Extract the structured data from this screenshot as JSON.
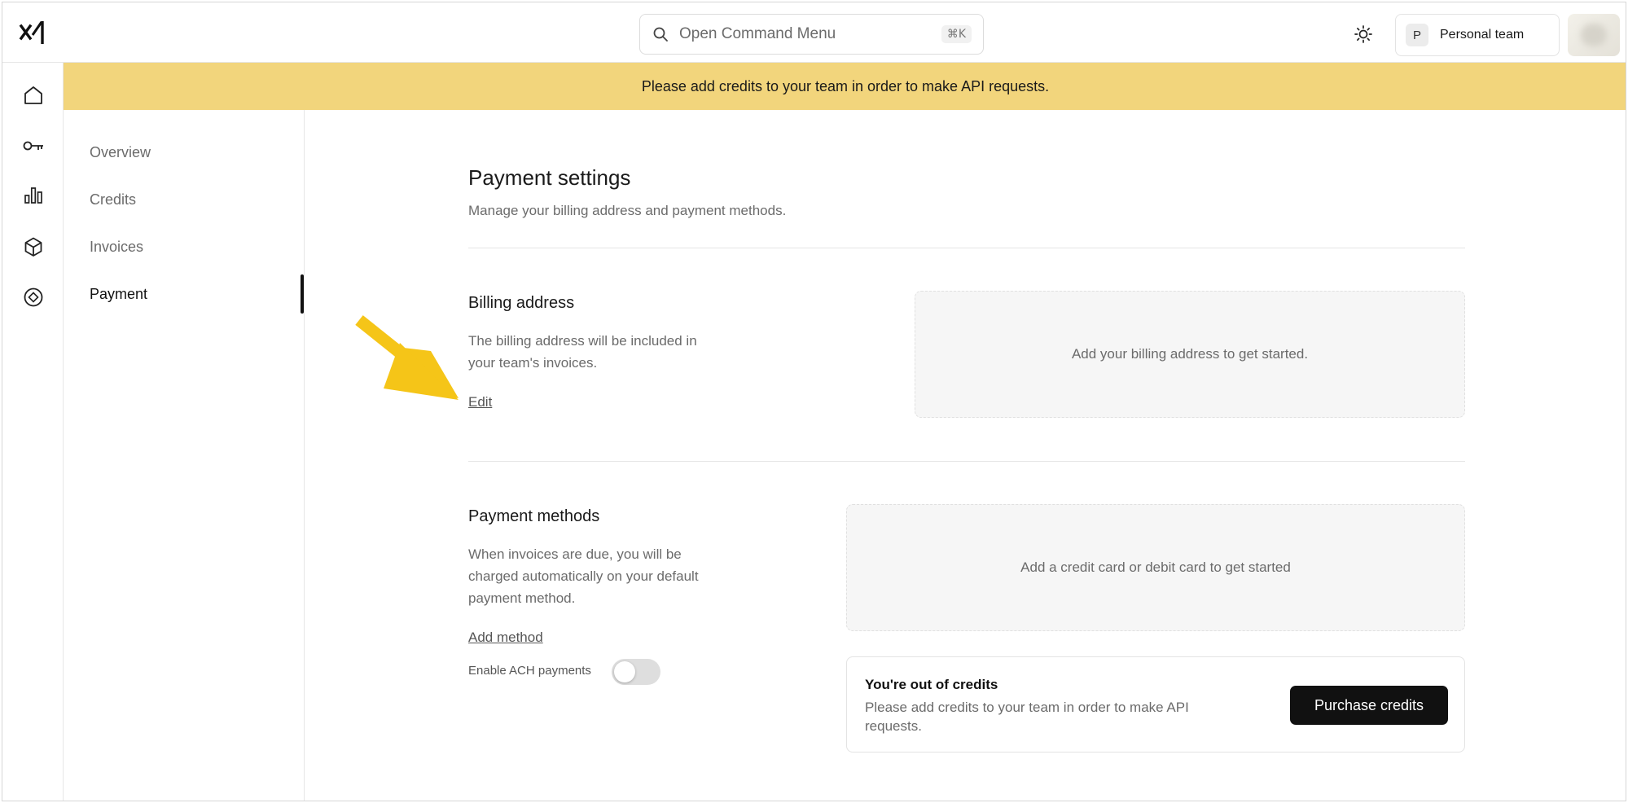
{
  "topbar": {
    "command_menu_placeholder": "Open Command Menu",
    "command_menu_shortcut": "⌘K",
    "team_initial": "P",
    "team_name": "Personal team"
  },
  "rail": {
    "icons": [
      "home-icon",
      "key-icon",
      "bar-chart-icon",
      "cube-icon",
      "compass-icon"
    ]
  },
  "banner": {
    "text": "Please add credits to your team in order to make API requests.",
    "color": "#f2d57c"
  },
  "submenu": {
    "items": [
      {
        "label": "Overview",
        "active": false
      },
      {
        "label": "Credits",
        "active": false
      },
      {
        "label": "Invoices",
        "active": false
      },
      {
        "label": "Payment",
        "active": true
      }
    ]
  },
  "main": {
    "title": "Payment settings",
    "subtitle": "Manage your billing address and payment methods.",
    "billing": {
      "title": "Billing address",
      "description_line1": "The billing address will be included in",
      "description_line2": "your team's invoices.",
      "edit_label": "Edit",
      "empty_text": "Add your billing address to get started."
    },
    "payment_methods": {
      "title": "Payment methods",
      "description_line1": "When invoices are due, you will be",
      "description_line2": "charged automatically on your default",
      "description_line3": "payment method.",
      "add_label": "Add method",
      "ach_label": "Enable ACH payments",
      "ach_enabled": false,
      "empty_text": "Add a credit card or debit card to get started"
    },
    "credits_card": {
      "title": "You're out of credits",
      "description_line1": "Please add credits to your team in order to make API",
      "description_line2": "requests.",
      "button_label": "Purchase credits"
    }
  },
  "annotation": {
    "arrow_color": "#f5c518"
  }
}
